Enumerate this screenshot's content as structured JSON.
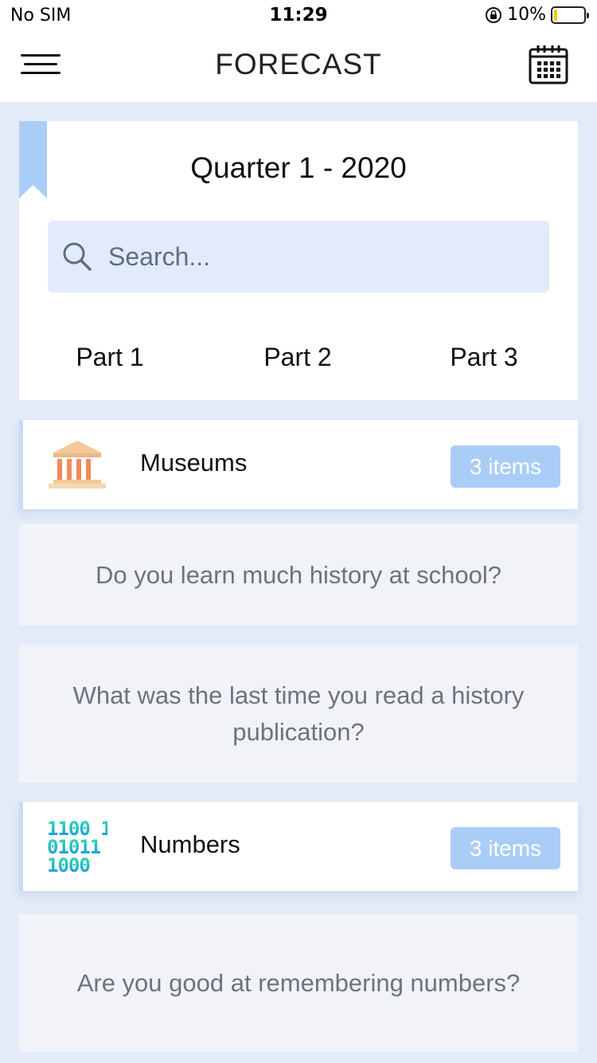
{
  "status_bar": {
    "carrier": "No SIM",
    "time": "11:29",
    "battery_percent": "10%",
    "battery_level": 0.1,
    "battery_color": "#f2c700"
  },
  "nav": {
    "title": "FORECAST",
    "menu_icon": "hamburger-menu-icon",
    "calendar_icon": "calendar-icon"
  },
  "header": {
    "quarter_title": "Quarter 1 - 2020",
    "search_placeholder": "Search...",
    "tabs": [
      {
        "label": "Part 1"
      },
      {
        "label": "Part 2"
      },
      {
        "label": "Part 3"
      }
    ]
  },
  "groups": [
    {
      "label": "Museums",
      "icon": "museum-icon",
      "badge": "3 items",
      "questions": [
        "Do you learn much history at school?",
        "What was the last time you read a history publication?"
      ]
    },
    {
      "label": "Numbers",
      "icon": "binary-numbers-icon",
      "badge": "3 items",
      "questions": [
        "Are you good at remembering numbers?"
      ]
    }
  ],
  "colors": {
    "page_background": "#e3ebf9",
    "badge": "#a9cdf7",
    "bookmark": "#a9cdf7",
    "search_background": "#e3ebfb"
  }
}
